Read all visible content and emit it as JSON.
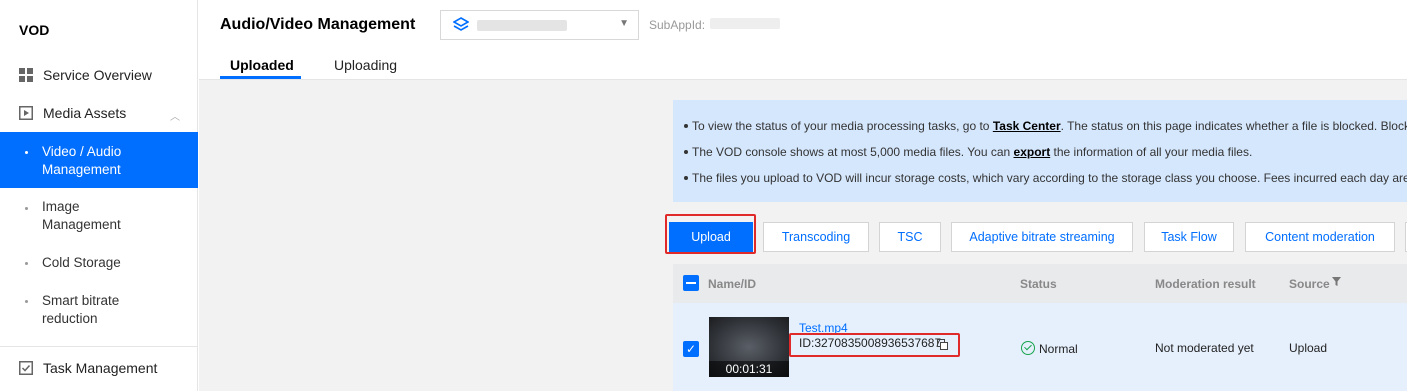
{
  "sidebar": {
    "brand": "VOD",
    "items": [
      {
        "label": "Service Overview",
        "icon": "grid-icon"
      },
      {
        "label": "Media Assets",
        "icon": "play-square-icon"
      },
      {
        "label": "Task Management",
        "icon": "checkbox-list-icon"
      }
    ],
    "subitems": [
      {
        "label": "Video / Audio Management",
        "active": true
      },
      {
        "label": "Image Management"
      },
      {
        "label": "Cold Storage"
      },
      {
        "label": "Smart bitrate reduction"
      }
    ]
  },
  "header": {
    "title": "Audio/Video Management",
    "subappid_label": "SubAppId:",
    "tabs": [
      {
        "label": "Uploaded",
        "active": true
      },
      {
        "label": "Uploading"
      }
    ]
  },
  "notice": {
    "lines": [
      {
        "before": "To view the status of your media processing tasks, go to ",
        "link": "Task Center",
        "after": ". The status on this page indicates whether a file is blocked. Block"
      },
      {
        "before": "The VOD console shows at most 5,000 media files. You can ",
        "link": "export",
        "after": " the information of all your media files."
      },
      {
        "before": "The files you upload to VOD will incur storage costs, which vary according to the storage class you choose. Fees incurred each day are",
        "link": "",
        "after": ""
      }
    ]
  },
  "toolbar": {
    "upload": "Upload",
    "transcoding": "Transcoding",
    "tsc": "TSC",
    "abs": "Adaptive bitrate streaming",
    "taskflow": "Task Flow",
    "moderation": "Content moderation"
  },
  "table": {
    "headers": {
      "name": "Name/ID",
      "status": "Status",
      "moderation": "Moderation result",
      "source": "Source"
    },
    "rows": [
      {
        "name": "Test.mp4",
        "id": "ID:3270835008936537687",
        "duration": "00:01:31",
        "status": "Normal",
        "moderation": "Not moderated yet",
        "source": "Upload",
        "checked": true
      }
    ]
  },
  "colors": {
    "accent": "#006eff",
    "highlight": "#e02a2a",
    "success": "#17a34a"
  }
}
